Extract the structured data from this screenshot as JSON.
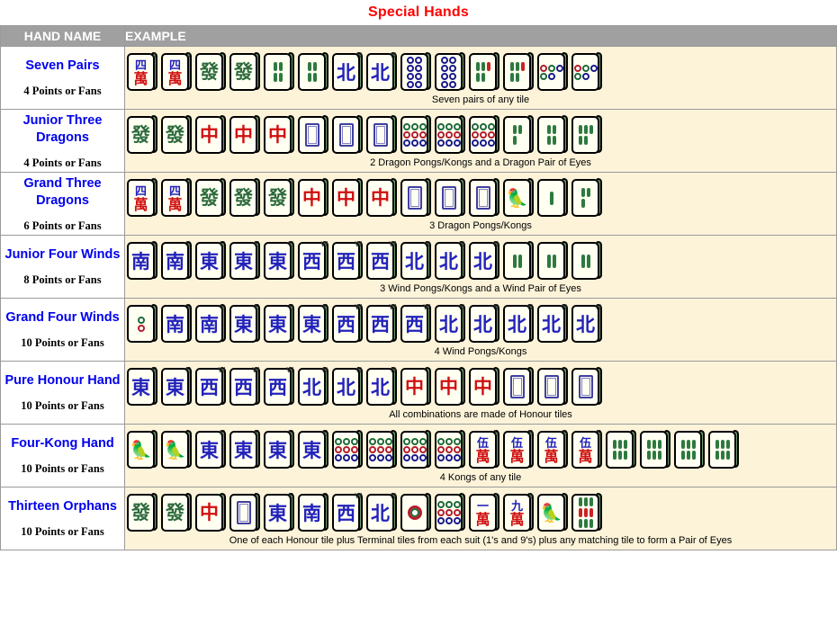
{
  "page": {
    "title": "Special Hands",
    "title_color": "#ff0000",
    "header_bg": "#a0a0a0",
    "example_bg": "#fcf3d9",
    "hand_name_color": "#0000ee"
  },
  "columns": {
    "hand_name": "HAND NAME",
    "example": "EXAMPLE"
  },
  "rows": [
    {
      "name": "Seven Pairs",
      "points": "4 Points or Fans",
      "caption": "Seven pairs of any tile",
      "tiles": [
        {
          "kind": "char",
          "top": "四",
          "bottom": "萬",
          "corner": "4"
        },
        {
          "kind": "char",
          "top": "四",
          "bottom": "萬",
          "corner": "4"
        },
        {
          "kind": "dragon-green",
          "glyph": "發"
        },
        {
          "kind": "dragon-green",
          "glyph": "發"
        },
        {
          "kind": "bamboo",
          "count": 4
        },
        {
          "kind": "bamboo",
          "count": 4
        },
        {
          "kind": "wind",
          "glyph": "北",
          "corner": "N"
        },
        {
          "kind": "wind",
          "glyph": "北",
          "corner": "N"
        },
        {
          "kind": "dots",
          "count": 8,
          "color": "b"
        },
        {
          "kind": "dots",
          "count": 8,
          "color": "b"
        },
        {
          "kind": "bamboo-mixed",
          "count": 5
        },
        {
          "kind": "bamboo-mixed",
          "count": 5
        },
        {
          "kind": "dots",
          "count": 5,
          "color": "mix"
        },
        {
          "kind": "dots",
          "count": 5,
          "color": "mix"
        }
      ]
    },
    {
      "name": "Junior Three Dragons",
      "points": "4 Points or Fans",
      "caption": "2 Dragon Pongs/Kongs and a Dragon Pair of Eyes",
      "tiles": [
        {
          "kind": "dragon-green",
          "glyph": "發"
        },
        {
          "kind": "dragon-green",
          "glyph": "發"
        },
        {
          "kind": "dragon-red",
          "glyph": "中"
        },
        {
          "kind": "dragon-red",
          "glyph": "中"
        },
        {
          "kind": "dragon-red",
          "glyph": "中"
        },
        {
          "kind": "dragon-white"
        },
        {
          "kind": "dragon-white"
        },
        {
          "kind": "dragon-white"
        },
        {
          "kind": "dots",
          "count": 9,
          "color": "mix"
        },
        {
          "kind": "dots",
          "count": 9,
          "color": "mix"
        },
        {
          "kind": "dots",
          "count": 9,
          "color": "mix"
        },
        {
          "kind": "bamboo",
          "count": 3
        },
        {
          "kind": "bamboo",
          "count": 4
        },
        {
          "kind": "bamboo",
          "count": 5
        }
      ]
    },
    {
      "name": "Grand Three Dragons",
      "points": "6 Points or Fans",
      "caption": "3 Dragon Pongs/Kongs",
      "tiles": [
        {
          "kind": "char",
          "top": "四",
          "bottom": "萬",
          "corner": "4"
        },
        {
          "kind": "char",
          "top": "四",
          "bottom": "萬",
          "corner": "4"
        },
        {
          "kind": "dragon-green",
          "glyph": "發"
        },
        {
          "kind": "dragon-green",
          "glyph": "發"
        },
        {
          "kind": "dragon-green",
          "glyph": "發"
        },
        {
          "kind": "dragon-red",
          "glyph": "中"
        },
        {
          "kind": "dragon-red",
          "glyph": "中"
        },
        {
          "kind": "dragon-red",
          "glyph": "中"
        },
        {
          "kind": "dragon-white"
        },
        {
          "kind": "dragon-white"
        },
        {
          "kind": "dragon-white"
        },
        {
          "kind": "flower",
          "glyph": "🦜"
        },
        {
          "kind": "bamboo",
          "count": 1
        },
        {
          "kind": "bamboo",
          "count": 3
        }
      ]
    },
    {
      "name": "Junior Four Winds",
      "points": "8 Points or Fans",
      "caption": "3 Wind Pongs/Kongs and a Wind Pair of Eyes",
      "tiles": [
        {
          "kind": "wind",
          "glyph": "南",
          "corner": "S"
        },
        {
          "kind": "wind",
          "glyph": "南",
          "corner": "S"
        },
        {
          "kind": "wind",
          "glyph": "東",
          "corner": "E"
        },
        {
          "kind": "wind",
          "glyph": "東",
          "corner": "E"
        },
        {
          "kind": "wind",
          "glyph": "東",
          "corner": "E"
        },
        {
          "kind": "wind",
          "glyph": "西",
          "corner": "W"
        },
        {
          "kind": "wind",
          "glyph": "西",
          "corner": "W"
        },
        {
          "kind": "wind",
          "glyph": "西",
          "corner": "W"
        },
        {
          "kind": "wind",
          "glyph": "北",
          "corner": "N"
        },
        {
          "kind": "wind",
          "glyph": "北",
          "corner": "N"
        },
        {
          "kind": "wind",
          "glyph": "北",
          "corner": "N"
        },
        {
          "kind": "bamboo",
          "count": 2
        },
        {
          "kind": "bamboo",
          "count": 2
        },
        {
          "kind": "bamboo",
          "count": 2
        }
      ]
    },
    {
      "name": "Grand Four Winds",
      "points": "10 Points or Fans",
      "caption": "4 Wind Pongs/Kongs",
      "tiles": [
        {
          "kind": "dots",
          "count": 2,
          "color": "mix"
        },
        {
          "kind": "wind",
          "glyph": "南",
          "corner": "S"
        },
        {
          "kind": "wind",
          "glyph": "南",
          "corner": "S"
        },
        {
          "kind": "wind",
          "glyph": "東",
          "corner": "E"
        },
        {
          "kind": "wind",
          "glyph": "東",
          "corner": "E"
        },
        {
          "kind": "wind",
          "glyph": "東",
          "corner": "E"
        },
        {
          "kind": "wind",
          "glyph": "西",
          "corner": "W"
        },
        {
          "kind": "wind",
          "glyph": "西",
          "corner": "W"
        },
        {
          "kind": "wind",
          "glyph": "西",
          "corner": "W"
        },
        {
          "kind": "wind",
          "glyph": "北",
          "corner": "N"
        },
        {
          "kind": "wind",
          "glyph": "北",
          "corner": "N"
        },
        {
          "kind": "wind",
          "glyph": "北",
          "corner": "N"
        },
        {
          "kind": "wind",
          "glyph": "北",
          "corner": "N"
        },
        {
          "kind": "wind",
          "glyph": "北",
          "corner": "N"
        }
      ]
    },
    {
      "name": "Pure Honour Hand",
      "points": "10 Points or Fans",
      "caption": "All combinations are made of Honour tiles",
      "tiles": [
        {
          "kind": "wind",
          "glyph": "東",
          "corner": "E"
        },
        {
          "kind": "wind",
          "glyph": "東",
          "corner": "E"
        },
        {
          "kind": "wind",
          "glyph": "西",
          "corner": "W"
        },
        {
          "kind": "wind",
          "glyph": "西",
          "corner": "W"
        },
        {
          "kind": "wind",
          "glyph": "西",
          "corner": "W"
        },
        {
          "kind": "wind",
          "glyph": "北",
          "corner": "N"
        },
        {
          "kind": "wind",
          "glyph": "北",
          "corner": "N"
        },
        {
          "kind": "wind",
          "glyph": "北",
          "corner": "N"
        },
        {
          "kind": "dragon-red",
          "glyph": "中"
        },
        {
          "kind": "dragon-red",
          "glyph": "中"
        },
        {
          "kind": "dragon-red",
          "glyph": "中"
        },
        {
          "kind": "dragon-white"
        },
        {
          "kind": "dragon-white"
        },
        {
          "kind": "dragon-white"
        }
      ]
    },
    {
      "name": "Four-Kong Hand",
      "points": "10 Points or Fans",
      "caption": "4 Kongs of any tile",
      "tiles": [
        {
          "kind": "flower",
          "glyph": "🦜"
        },
        {
          "kind": "flower",
          "glyph": "🦜"
        },
        {
          "kind": "wind",
          "glyph": "東",
          "corner": "E"
        },
        {
          "kind": "wind",
          "glyph": "東",
          "corner": "E"
        },
        {
          "kind": "wind",
          "glyph": "東",
          "corner": "E"
        },
        {
          "kind": "wind",
          "glyph": "東",
          "corner": "E"
        },
        {
          "kind": "dots",
          "count": 9,
          "color": "mix"
        },
        {
          "kind": "dots",
          "count": 9,
          "color": "mix"
        },
        {
          "kind": "dots",
          "count": 9,
          "color": "mix"
        },
        {
          "kind": "dots",
          "count": 9,
          "color": "mix"
        },
        {
          "kind": "char",
          "top": "伍",
          "bottom": "萬",
          "corner": "5"
        },
        {
          "kind": "char",
          "top": "伍",
          "bottom": "萬",
          "corner": "5"
        },
        {
          "kind": "char",
          "top": "伍",
          "bottom": "萬",
          "corner": "5"
        },
        {
          "kind": "char",
          "top": "伍",
          "bottom": "萬",
          "corner": "5"
        },
        {
          "kind": "bamboo",
          "count": 6
        },
        {
          "kind": "bamboo",
          "count": 6
        },
        {
          "kind": "bamboo",
          "count": 6
        },
        {
          "kind": "bamboo",
          "count": 6
        }
      ]
    },
    {
      "name": "Thirteen Orphans",
      "points": "10 Points or Fans",
      "caption": "One of each Honour tile plus Terminal tiles from each suit (1's and 9's) plus any matching tile to form a Pair of Eyes",
      "tiles": [
        {
          "kind": "dragon-green",
          "glyph": "發"
        },
        {
          "kind": "dragon-green",
          "glyph": "發"
        },
        {
          "kind": "dragon-red",
          "glyph": "中"
        },
        {
          "kind": "dragon-white"
        },
        {
          "kind": "wind",
          "glyph": "東",
          "corner": "E"
        },
        {
          "kind": "wind",
          "glyph": "南",
          "corner": "S"
        },
        {
          "kind": "wind",
          "glyph": "西",
          "corner": "W"
        },
        {
          "kind": "wind",
          "glyph": "北",
          "corner": "N"
        },
        {
          "kind": "dots",
          "count": 1,
          "color": "big"
        },
        {
          "kind": "dots",
          "count": 9,
          "color": "mix"
        },
        {
          "kind": "char",
          "top": "一",
          "bottom": "萬",
          "corner": "1"
        },
        {
          "kind": "char",
          "top": "九",
          "bottom": "萬",
          "corner": "9"
        },
        {
          "kind": "flower",
          "glyph": "🦜"
        },
        {
          "kind": "bamboo-mixed",
          "count": 9
        }
      ]
    }
  ]
}
